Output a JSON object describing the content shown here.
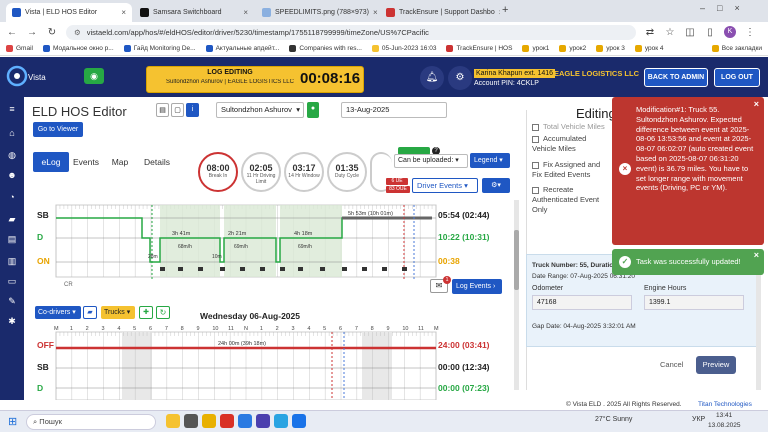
{
  "browser": {
    "tabs": [
      {
        "title": "Vista | ELD HOS Editor",
        "color": "#1f57c3",
        "active": true
      },
      {
        "title": "Samsara Switchboard",
        "color": "#111111",
        "active": false
      },
      {
        "title": "SPEEDLIMITS.png (788×973)",
        "color": "#8bb0e0",
        "active": false
      },
      {
        "title": "TrackEnsure | Support Dashbo",
        "color": "#c33",
        "active": false
      }
    ],
    "url": "vistaeld.com/app/hos/#/eldHOS/editor/driver/5230/timestamp/1755118799999/timeZone/US%7CPacific",
    "bookmarks": [
      "Gmail",
      "Модальное окно р...",
      "Гайд Monitoring De...",
      "Актуальные апдейт...",
      "Companies with res...",
      "05-Jun-2023 16:03",
      "TrackEnsure | HOS",
      "урок1",
      "урок2",
      "урок 3",
      "урок 4"
    ],
    "all_bookmarks": "Все закладки",
    "profile": "K"
  },
  "header": {
    "logo": "Vista",
    "log_title": "LOG EDITING",
    "log_sub": "Sultondzhon Ashurov | EAGLE LOGISTICS LLC",
    "timer": "00:08:16",
    "driver_name": "Karina Khapun ext. 1416",
    "company": "EAGLE LOGISTICS LLC",
    "account": "Account PIN: 4CKLP",
    "back_admin": "BACK TO ADMIN",
    "logout": "LOG OUT"
  },
  "editor": {
    "title": "ELD HOS Editor",
    "driver": "Sultondzhon Ashurov",
    "date": "13-Aug-2025",
    "go_viewer": "Go to Viewer",
    "tabs": [
      "eLog",
      "Events",
      "Map",
      "Details"
    ],
    "gauges": [
      {
        "value": "08:00",
        "label": "Break In"
      },
      {
        "value": "02:05",
        "label": "11 Hr Driving Limit"
      },
      {
        "value": "03:17",
        "label": "14 Hr Window"
      },
      {
        "value": "01:35",
        "label": "Duty Cycle"
      }
    ],
    "uploaded_label": "Can be uploaded:",
    "legend": "Legend",
    "driver_events": "Driver Events",
    "badge1": "6 UE",
    "badge2": "83 OUE",
    "log_events": "Log Events",
    "cr": "CR",
    "notes_count": "1",
    "graph1": {
      "rows": [
        {
          "label": "SB",
          "total": "05:54 (02:44)",
          "color": "#222"
        },
        {
          "label": "D",
          "total": "10:22 (10:31)",
          "color": "#27a844"
        },
        {
          "label": "ON",
          "total": "00:38",
          "color": "#e8a400"
        }
      ],
      "drive_labels": [
        "3h 41m",
        "2h 21m",
        "4h 18m"
      ],
      "speed_labels": [
        "68m/h",
        "69m/h",
        "69m/h"
      ],
      "sb_label": "5h 53m (10h 01m)",
      "on_label1": "28m",
      "on_label2": "10m"
    },
    "toolbar2": {
      "codrivers": "Co-drivers",
      "trucks": "Trucks"
    },
    "day2_title": "Wednesday 06-Aug-2025",
    "graph2": {
      "hours": [
        "M",
        "1",
        "2",
        "3",
        "4",
        "5",
        "6",
        "7",
        "8",
        "9",
        "10",
        "11",
        "N",
        "1",
        "2",
        "3",
        "4",
        "5",
        "6",
        "7",
        "8",
        "9",
        "10",
        "11",
        "M"
      ],
      "rows": [
        {
          "label": "OFF",
          "total": "24:00 (03:41)",
          "color": "#c33"
        },
        {
          "label": "SB",
          "total": "00:00 (12:34)",
          "color": "#222"
        },
        {
          "label": "D",
          "total": "00:00 (07:23)",
          "color": "#27a844"
        }
      ],
      "off_label": "24h 00m (39h 18m)"
    }
  },
  "edit_panel": {
    "heading": "Editing",
    "checks": [
      "Total Vehicle Miles",
      "Accumulated Vehicle Miles",
      "Fix Assigned and Fix Edited Events",
      "Recreate Authenticated Event Only"
    ],
    "truck_number": "Truck Number: 55, Duration",
    "date_range": "Date Range: 07-Aug-2025 06:31:20",
    "odometer_label": "Odometer",
    "odometer": "47168",
    "engine_label": "Engine Hours",
    "engine": "1399.1",
    "gap": "Gap Date: 04-Aug-2025 3:32:01 AM",
    "cancel": "Cancel",
    "preview": "Preview"
  },
  "toasts": {
    "error": "Modification#1: Truck 55. Sultondzhon Ashurov. Expected difference between event at 2025-08-06 13:53:56 and event at 2025-08-07 06:02:07 (auto created event based on 2025-08-07 06:31:20 event) is 36.79 miles. You have to set longer range with movement events (Driving, PC or YM).",
    "success": "Task was successfully updated!"
  },
  "footer": {
    "copyright": "© Vista ELD . 2025 All Rights Reserved.",
    "titan": "Titan Technologies"
  },
  "taskbar": {
    "search": "Пошук",
    "weather": "27°C Sunny",
    "lang": "УКР",
    "time": "13:41",
    "date": "13.08.2025"
  }
}
